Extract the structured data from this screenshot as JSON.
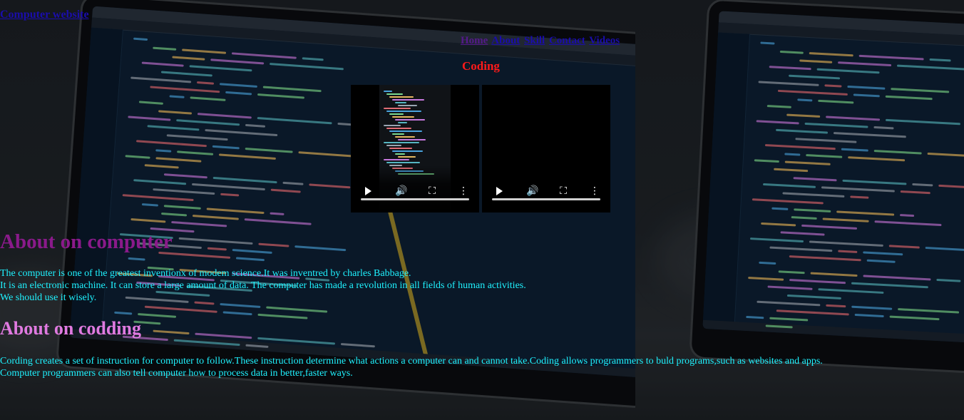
{
  "header": {
    "site_title": "Computer website"
  },
  "nav": {
    "items": [
      {
        "label": "Home",
        "visited": true
      },
      {
        "label": "About",
        "visited": false
      },
      {
        "label": "Skill",
        "visited": false
      },
      {
        "label": "Contact",
        "visited": false
      },
      {
        "label": "Videos",
        "visited": false
      }
    ]
  },
  "videos_section": {
    "title": "Coding",
    "videos": [
      {
        "state": "paused",
        "controls": [
          "play-icon",
          "volume-icon",
          "fullscreen-icon",
          "more-options-icon"
        ]
      },
      {
        "state": "paused",
        "controls": [
          "play-icon",
          "volume-icon",
          "fullscreen-icon",
          "more-options-icon"
        ]
      }
    ]
  },
  "about_computer": {
    "heading": "About on computer",
    "lines": [
      "The computer is one of the greatest inventionx of modem science.It was inventred by charles Babbage.",
      "It is an electronic machine. It can store a large amount of data. The computer has made a revolution in all fields of human activities.",
      "We should use it wisely."
    ]
  },
  "about_coding": {
    "heading": "About on codding",
    "lines": [
      "Cording creates a set of instruction for computer to follow.These instruction determine what actions a computer can and cannot take.Coding allows programmers to buld programs,such as websites and apps.",
      "Computer programmers can also tell computer how to process data in better,faster ways."
    ]
  },
  "colors": {
    "link": "#1a0dab",
    "link_visited": "#551a8b",
    "coding_title": "#ff1a1a",
    "about_heading": "#8a1a8a",
    "codding_heading": "#e07ae0",
    "paragraph_text": "#1ff2ff"
  }
}
